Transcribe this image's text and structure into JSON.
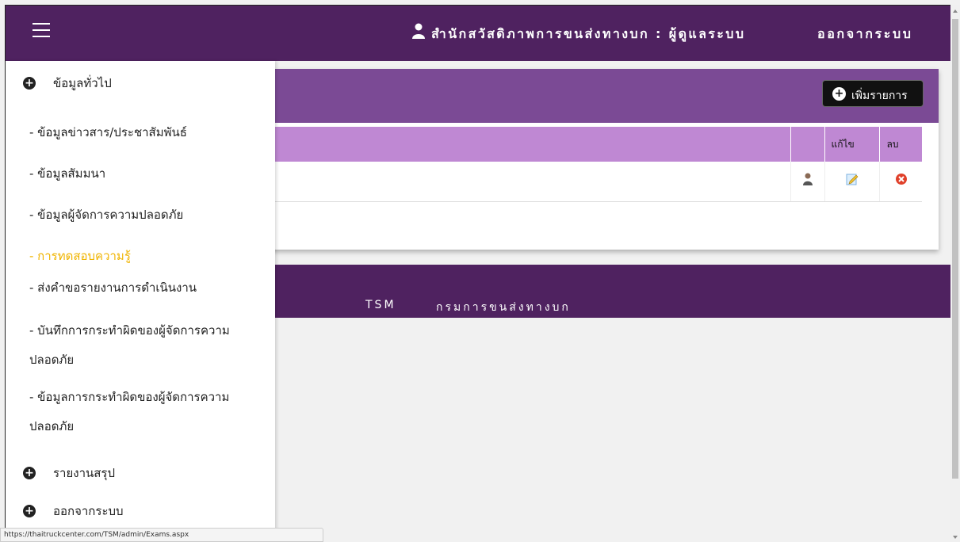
{
  "header": {
    "title": "สำนักสวัสดิภาพการขนส่งทางบก : ผู้ดูแลระบบ",
    "logout": "ออกจากระบบ",
    "menu_icon": "hamburger-icon",
    "user_icon": "user-icon"
  },
  "panel": {
    "add_button": "เพิ่มรายการ",
    "table": {
      "headers": [
        "",
        "",
        "แก้ไข",
        "ลบ"
      ],
      "rows": [
        {
          "icons": [
            "user-icon",
            "edit-icon",
            "delete-icon"
          ]
        }
      ]
    }
  },
  "footer": {
    "tsm": "TSM",
    "department": "กรมการขนส่งทางบก"
  },
  "sidebar": {
    "items": [
      {
        "label": "ข้อมูลทั่วไป",
        "type": "main"
      },
      {
        "label": "- ข้อมูลข่าวสาร/ประชาสัมพันธ์",
        "type": "sub"
      },
      {
        "label": "- ข้อมูลสัมมนา",
        "type": "sub"
      },
      {
        "label": "- ข้อมูลผู้จัดการความปลอดภัย",
        "type": "sub"
      },
      {
        "label": "- การทดสอบความรู้",
        "type": "sub",
        "active": true
      },
      {
        "label": "- ส่งคำขอรายงานการดำเนินงาน",
        "type": "sub"
      },
      {
        "label": "- บันทึกการกระทำผิดของผู้จัดการความปลอดภัย",
        "type": "sub"
      },
      {
        "label": "- ข้อมูลการกระทำผิดของผู้จัดการความปลอดภัย",
        "type": "sub"
      },
      {
        "label": "รายงานสรุป",
        "type": "main"
      },
      {
        "label": "ออกจากระบบ",
        "type": "main"
      }
    ]
  },
  "status_bar": {
    "url": "https://thaitruckcenter.com/TSM/admin/Exams.aspx"
  },
  "colors": {
    "header_bg": "#4f2260",
    "panel_head_bg": "#7b4a95",
    "table_head_bg": "#bf88d3",
    "active_item": "#f0b400"
  }
}
